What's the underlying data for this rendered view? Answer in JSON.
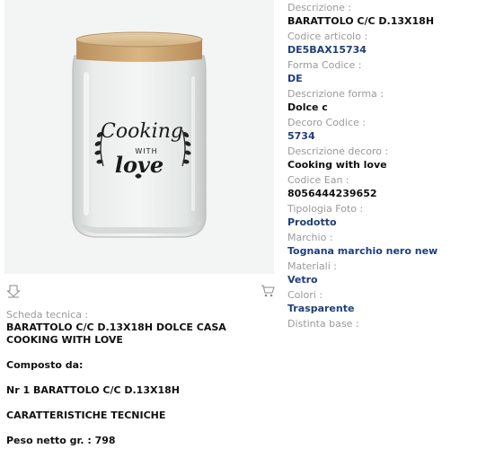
{
  "product_image": {
    "alt": "Glass storage jar with wooden lid",
    "print": [
      "Cooking",
      "WITH",
      "love"
    ]
  },
  "toolbar": {
    "download_icon": "download-icon",
    "cart_icon": "cart-icon"
  },
  "tech_sheet": {
    "label": "Scheda tecnica :",
    "title": "BARATTOLO C/C D.13X18H DOLCE CASA COOKING WITH LOVE",
    "composition_label": "Composto da:",
    "composition_item": "Nr 1 BARATTOLO C/C D.13X18H",
    "specs_heading": "CARATTERISTICHE TECNICHE",
    "net_weight": "Peso netto gr. : 798"
  },
  "properties": [
    {
      "label": "Descrizione :",
      "value": "BARATTOLO C/C D.13X18H",
      "style": "dark"
    },
    {
      "label": "Codice articolo :",
      "value": "DE5BAX15734",
      "style": "blue"
    },
    {
      "label": "Forma Codice :",
      "value": "DE",
      "style": "blue"
    },
    {
      "label": "Descrizione forma :",
      "value": "Dolce c",
      "style": "dark"
    },
    {
      "label": "Decoro Codice :",
      "value": "5734",
      "style": "blue"
    },
    {
      "label": "Descrizione decoro :",
      "value": "Cooking with love",
      "style": "dark"
    },
    {
      "label": "Codice Ean :",
      "value": "8056444239652",
      "style": "dark"
    },
    {
      "label": "Tipologia Foto :",
      "value": "Prodotto",
      "style": "blue"
    },
    {
      "label": "Marchio :",
      "value": "Tognana marchio nero new",
      "style": "blue"
    },
    {
      "label": "Materiali :",
      "value": "Vetro",
      "style": "blue"
    },
    {
      "label": "Colori :",
      "value": "Trasparente",
      "style": "blue"
    },
    {
      "label": "Distinta base :",
      "value": "",
      "style": "dark"
    }
  ]
}
